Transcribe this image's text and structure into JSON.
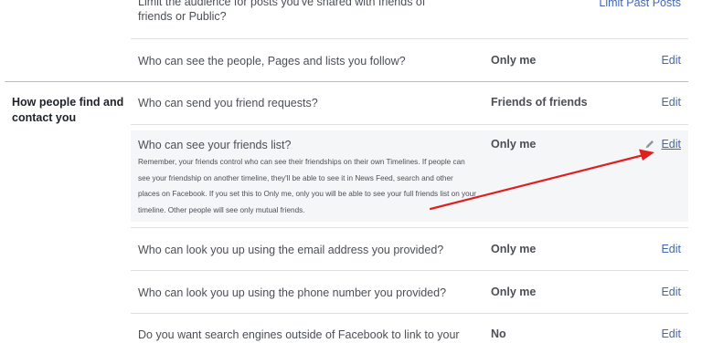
{
  "section": {
    "label": "How people find and contact you"
  },
  "rows": [
    {
      "question": "Limit the audience for posts you've shared with friends of friends or Public?",
      "value": "",
      "edit": "Limit Past Posts"
    },
    {
      "question": "Who can see the people, Pages and lists you follow?",
      "value": "Only me",
      "edit": "Edit"
    },
    {
      "question": "Who can send you friend requests?",
      "value": "Friends of friends",
      "edit": "Edit"
    },
    {
      "question": "Who can see your friends list?",
      "value": "Only me",
      "edit": "Edit",
      "description": "Remember, your friends control who can see their friendships on their own Timelines. If people can see your friendship on another timeline, they'll be able to see it in News Feed, search and other places on Facebook. If you set this to Only me, only you will be able to see your full friends list on your timeline. Other people will see only mutual friends."
    },
    {
      "question": "Who can look you up using the email address you provided?",
      "value": "Only me",
      "edit": "Edit"
    },
    {
      "question": "Who can look you up using the phone number you provided?",
      "value": "Only me",
      "edit": "Edit"
    },
    {
      "question": "Do you want search engines outside of Facebook to link to your",
      "value": "No",
      "edit": "Edit"
    }
  ],
  "colors": {
    "link": "#4267b2",
    "annotation_arrow": "#e02020",
    "highlight_bg": "#f5f6f7"
  },
  "icons": {
    "edit": "pencil-icon"
  }
}
